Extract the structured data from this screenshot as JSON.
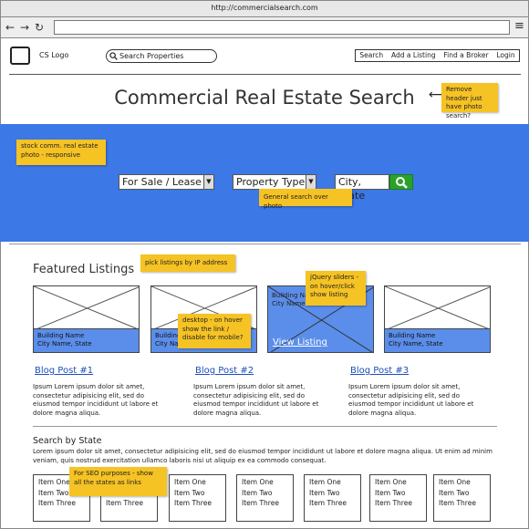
{
  "browser": {
    "url": "http://commercialsearch.com",
    "back_glyph": "←",
    "forward_glyph": "→",
    "reload_glyph": "↻",
    "menu_glyph": "≡"
  },
  "header": {
    "logo_label": "CS Logo",
    "search_placeholder": "Search Properties",
    "nav": [
      "Search",
      "Add a Listing",
      "Find a Broker",
      "Login"
    ]
  },
  "title": "Commercial Real Estate Search",
  "hero": {
    "sale_lease": "For Sale / Lease",
    "property_type": "Property Type",
    "location": "City, State",
    "dropdown_glyph": "▼"
  },
  "featured": {
    "heading": "Featured Listings",
    "listings": [
      {
        "name": "Building Name",
        "location": "City Name, State"
      },
      {
        "name": "Building Name",
        "location": "City Name, State"
      },
      {
        "name": "Building Name",
        "location": "City Name",
        "link": "View Listing"
      },
      {
        "name": "Building Name",
        "location": "City Name, State"
      }
    ]
  },
  "blog": [
    {
      "title": "Blog Post #1",
      "body": "Ipsum Lorem ipsum dolor sit amet, consectetur adipisicing elit, sed do eiusmod tempor incididunt ut labore et dolore magna aliqua."
    },
    {
      "title": "Blog Post #2",
      "body": "Ipsum Lorem ipsum dolor sit amet, consectetur adipisicing elit, sed do eiusmod tempor incididunt ut labore et dolore magna aliqua."
    },
    {
      "title": "Blog Post #3",
      "body": "Ipsum Lorem ipsum dolor sit amet, consectetur adipisicing elit, sed do eiusmod tempor incididunt ut labore et dolore magna aliqua."
    }
  ],
  "state_search": {
    "heading": "Search by State",
    "body": "Lorem ipsum dolor sit amet, consectetur adipisicing elit, sed do eiusmod tempor incididunt ut labore et dolore magna aliqua. Ut enim ad minim veniam, quis nostrud exercitation ullamco laboris nisi ut aliquip ex ea commodo consequat.",
    "items": [
      "Item One",
      "Item Two",
      "Item Three"
    ]
  },
  "notes": {
    "remove_header": "Remove header just have photo search?",
    "stock_photo": "stock comm. real estate photo - responsive",
    "general_search": "General search over photo",
    "pick_listings": "pick listings by IP address",
    "jquery_sliders": "jQuery sliders - on hover/click show listing",
    "desktop_hover": "desktop - on hover show the link / disable for mobile?",
    "seo": "For SEO purposes - show all the states as links"
  },
  "colors": {
    "hero": "#3c78e6",
    "sticky": "#f6c324",
    "go_button": "#2aa22a",
    "link": "#1c4fb8"
  }
}
